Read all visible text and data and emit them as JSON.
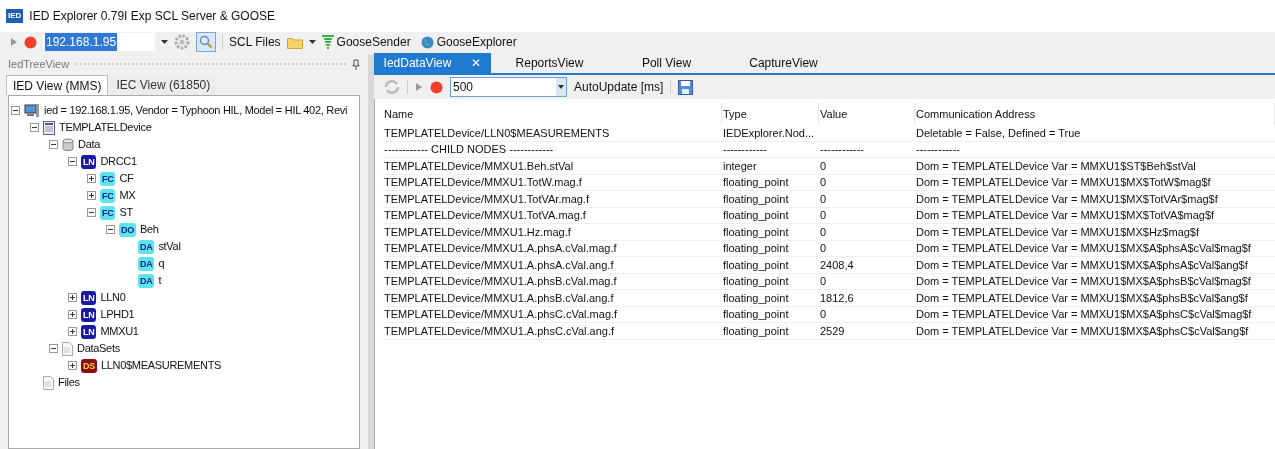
{
  "window": {
    "title": "IED Explorer 0.79I Exp SCL Server & GOOSE",
    "logo": "IED"
  },
  "toolbar": {
    "address": "192.168.1.95",
    "scl_files": "SCL Files",
    "goose_sender": "GooseSender",
    "goose_explorer": "GooseExplorer"
  },
  "tree_panel": {
    "title": "IedTreeView",
    "tabs": [
      {
        "label": "IED View (MMS)",
        "selected": true
      },
      {
        "label": "IEC View (61850)",
        "selected": false
      }
    ],
    "tree": [
      {
        "kind": "computer",
        "label": "ied = 192.168.1.95, Vendor = Typhoon HIL, Model = HIL 402, Revi",
        "expanded": true,
        "children": [
          {
            "kind": "device",
            "label": "TEMPLATELDevice",
            "expanded": true,
            "children": [
              {
                "kind": "data",
                "label": "Data",
                "expanded": true,
                "children": [
                  {
                    "kind": "LN",
                    "badge": "LN",
                    "label": "DRCC1",
                    "expanded": true,
                    "children": [
                      {
                        "kind": "FC",
                        "badge": "FC",
                        "label": "CF",
                        "expanded": false
                      },
                      {
                        "kind": "FC",
                        "badge": "FC",
                        "label": "MX",
                        "expanded": false
                      },
                      {
                        "kind": "FC",
                        "badge": "FC",
                        "label": "ST",
                        "expanded": true,
                        "children": [
                          {
                            "kind": "DO",
                            "badge": "DO",
                            "label": "Beh",
                            "expanded": true,
                            "children": [
                              {
                                "kind": "DA",
                                "badge": "DA",
                                "label": "stVal"
                              },
                              {
                                "kind": "DA",
                                "badge": "DA",
                                "label": "q"
                              },
                              {
                                "kind": "DA",
                                "badge": "DA",
                                "label": "t"
                              }
                            ]
                          }
                        ]
                      }
                    ]
                  },
                  {
                    "kind": "LN",
                    "badge": "LN",
                    "label": "LLN0",
                    "expanded": false
                  },
                  {
                    "kind": "LN",
                    "badge": "LN",
                    "label": "LPHD1",
                    "expanded": false
                  },
                  {
                    "kind": "LN",
                    "badge": "LN",
                    "label": "MMXU1",
                    "expanded": false
                  }
                ]
              },
              {
                "kind": "page",
                "label": "DataSets",
                "expanded": true,
                "children": [
                  {
                    "kind": "DS",
                    "badge": "DS",
                    "label": "LLN0$MEASUREMENTS",
                    "expanded": false
                  }
                ]
              }
            ]
          },
          {
            "kind": "page",
            "label": "Files"
          }
        ]
      }
    ]
  },
  "data_panel": {
    "tabs": [
      {
        "label": "IedDataView",
        "selected": true,
        "close": "✕"
      },
      {
        "label": "ReportsView",
        "selected": false
      },
      {
        "label": "Poll View",
        "selected": false
      },
      {
        "label": "CaptureView",
        "selected": false
      }
    ],
    "interval": "500",
    "interval_label": "AutoUpdate [ms]",
    "table": {
      "columns": [
        "Name",
        "Type",
        "Value",
        "Communication Address"
      ],
      "rows": [
        [
          "TEMPLATELDevice/LLN0$MEASUREMENTS",
          "IEDExplorer.Nod...",
          "",
          "Deletable = False, Defined = True"
        ],
        [
          "------------ CHILD NODES ------------",
          "------------",
          "------------",
          "------------"
        ],
        [
          "TEMPLATELDevice/MMXU1.Beh.stVal",
          "integer",
          "0",
          "Dom = TEMPLATELDevice Var = MMXU1$ST$Beh$stVal"
        ],
        [
          "TEMPLATELDevice/MMXU1.TotW.mag.f",
          "floating_point",
          "0",
          "Dom = TEMPLATELDevice Var = MMXU1$MX$TotW$mag$f"
        ],
        [
          "TEMPLATELDevice/MMXU1.TotVAr.mag.f",
          "floating_point",
          "0",
          "Dom = TEMPLATELDevice Var = MMXU1$MX$TotVAr$mag$f"
        ],
        [
          "TEMPLATELDevice/MMXU1.TotVA.mag.f",
          "floating_point",
          "0",
          "Dom = TEMPLATELDevice Var = MMXU1$MX$TotVA$mag$f"
        ],
        [
          "TEMPLATELDevice/MMXU1.Hz.mag.f",
          "floating_point",
          "0",
          "Dom = TEMPLATELDevice Var = MMXU1$MX$Hz$mag$f"
        ],
        [
          "TEMPLATELDevice/MMXU1.A.phsA.cVal.mag.f",
          "floating_point",
          "0",
          "Dom = TEMPLATELDevice Var = MMXU1$MX$A$phsA$cVal$mag$f"
        ],
        [
          "TEMPLATELDevice/MMXU1.A.phsA.cVal.ang.f",
          "floating_point",
          "2408,4",
          "Dom = TEMPLATELDevice Var = MMXU1$MX$A$phsA$cVal$ang$f"
        ],
        [
          "TEMPLATELDevice/MMXU1.A.phsB.cVal.mag.f",
          "floating_point",
          "0",
          "Dom = TEMPLATELDevice Var = MMXU1$MX$A$phsB$cVal$mag$f"
        ],
        [
          "TEMPLATELDevice/MMXU1.A.phsB.cVal.ang.f",
          "floating_point",
          "1812,6",
          "Dom = TEMPLATELDevice Var = MMXU1$MX$A$phsB$cVal$ang$f"
        ],
        [
          "TEMPLATELDevice/MMXU1.A.phsC.cVal.mag.f",
          "floating_point",
          "0",
          "Dom = TEMPLATELDevice Var = MMXU1$MX$A$phsC$cVal$mag$f"
        ],
        [
          "TEMPLATELDevice/MMXU1.A.phsC.cVal.ang.f",
          "floating_point",
          "2529",
          "Dom = TEMPLATELDevice Var = MMXU1$MX$A$phsC$cVal$ang$f"
        ]
      ]
    }
  }
}
